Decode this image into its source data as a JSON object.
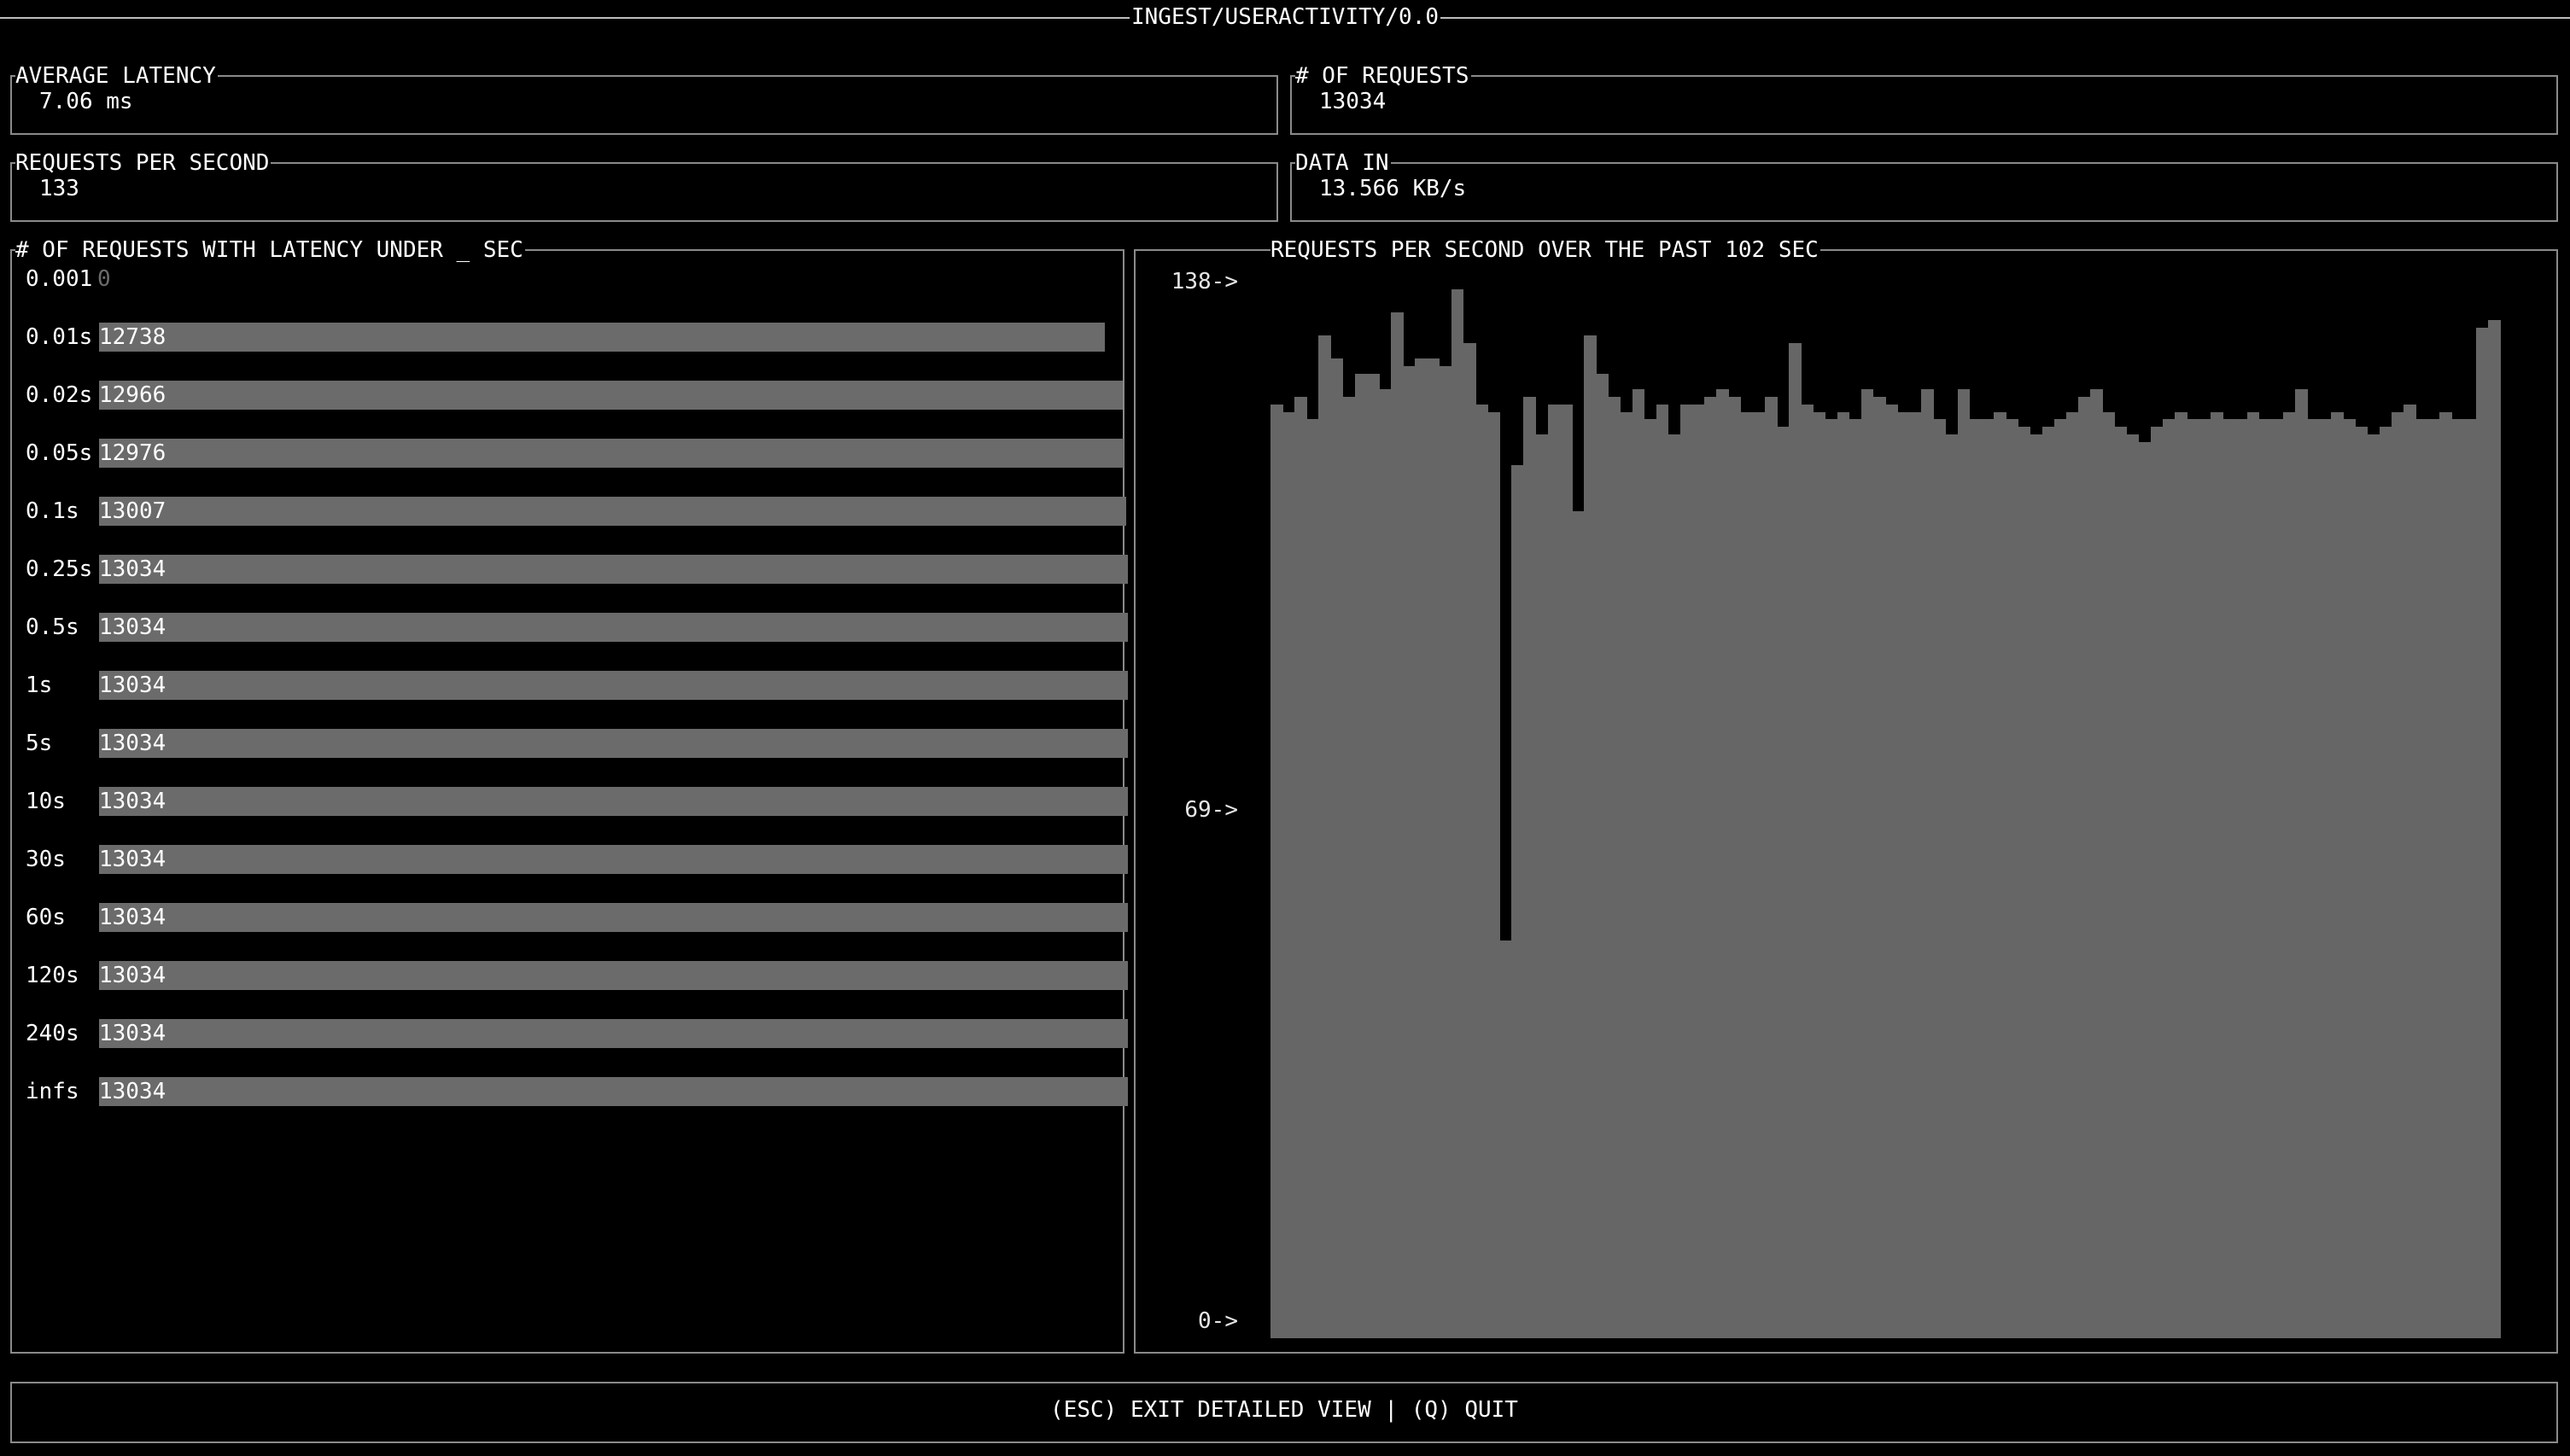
{
  "title": "INGEST/USERACTIVITY/0.0",
  "stats": {
    "avg_latency_label": "AVERAGE LATENCY",
    "avg_latency_value": "7.06 ms",
    "num_requests_label": "# OF REQUESTS",
    "num_requests_value": "13034",
    "rps_label": "REQUESTS PER SECOND",
    "rps_value": "133",
    "data_in_label": "DATA IN",
    "data_in_value": "13.566 KB/s"
  },
  "histogram": {
    "title": "# OF REQUESTS WITH LATENCY UNDER _ SEC",
    "max": 13034,
    "rows": [
      {
        "label": "0.001",
        "count": 0
      },
      {
        "label": "0.01s",
        "count": 12738
      },
      {
        "label": "0.02s",
        "count": 12966
      },
      {
        "label": "0.05s",
        "count": 12976
      },
      {
        "label": "0.1s",
        "count": 13007
      },
      {
        "label": "0.25s",
        "count": 13034
      },
      {
        "label": "0.5s",
        "count": 13034
      },
      {
        "label": "1s",
        "count": 13034
      },
      {
        "label": "5s",
        "count": 13034
      },
      {
        "label": "10s",
        "count": 13034
      },
      {
        "label": "30s",
        "count": 13034
      },
      {
        "label": "60s",
        "count": 13034
      },
      {
        "label": "120s",
        "count": 13034
      },
      {
        "label": "240s",
        "count": 13034
      },
      {
        "label": "infs",
        "count": 13034
      }
    ]
  },
  "chart_data": {
    "type": "bar",
    "title": "REQUESTS PER SECOND OVER THE PAST 102 SEC",
    "ylim": [
      0,
      138
    ],
    "y_ticks": [
      {
        "value": 138,
        "label": "138->"
      },
      {
        "value": 69,
        "label": "69->"
      },
      {
        "value": 0,
        "label": "0->"
      }
    ],
    "values": [
      122,
      121,
      123,
      120,
      131,
      128,
      123,
      126,
      126,
      124,
      134,
      127,
      128,
      128,
      127,
      137,
      130,
      122,
      121,
      52,
      114,
      123,
      118,
      122,
      122,
      108,
      131,
      126,
      123,
      121,
      124,
      120,
      122,
      118,
      122,
      122,
      123,
      124,
      123,
      121,
      121,
      123,
      119,
      130,
      122,
      121,
      120,
      121,
      120,
      124,
      123,
      122,
      121,
      121,
      124,
      120,
      118,
      124,
      120,
      120,
      121,
      120,
      119,
      118,
      119,
      120,
      121,
      123,
      124,
      121,
      119,
      118,
      117,
      119,
      120,
      121,
      120,
      120,
      121,
      120,
      120,
      121,
      120,
      120,
      121,
      124,
      120,
      120,
      121,
      120,
      119,
      118,
      119,
      121,
      122,
      120,
      120,
      121,
      120,
      120,
      132,
      133
    ]
  },
  "footer": {
    "esc_label": "(ESC) EXIT DETAILED VIEW",
    "separator": "|",
    "quit_label": "(Q) QUIT"
  }
}
